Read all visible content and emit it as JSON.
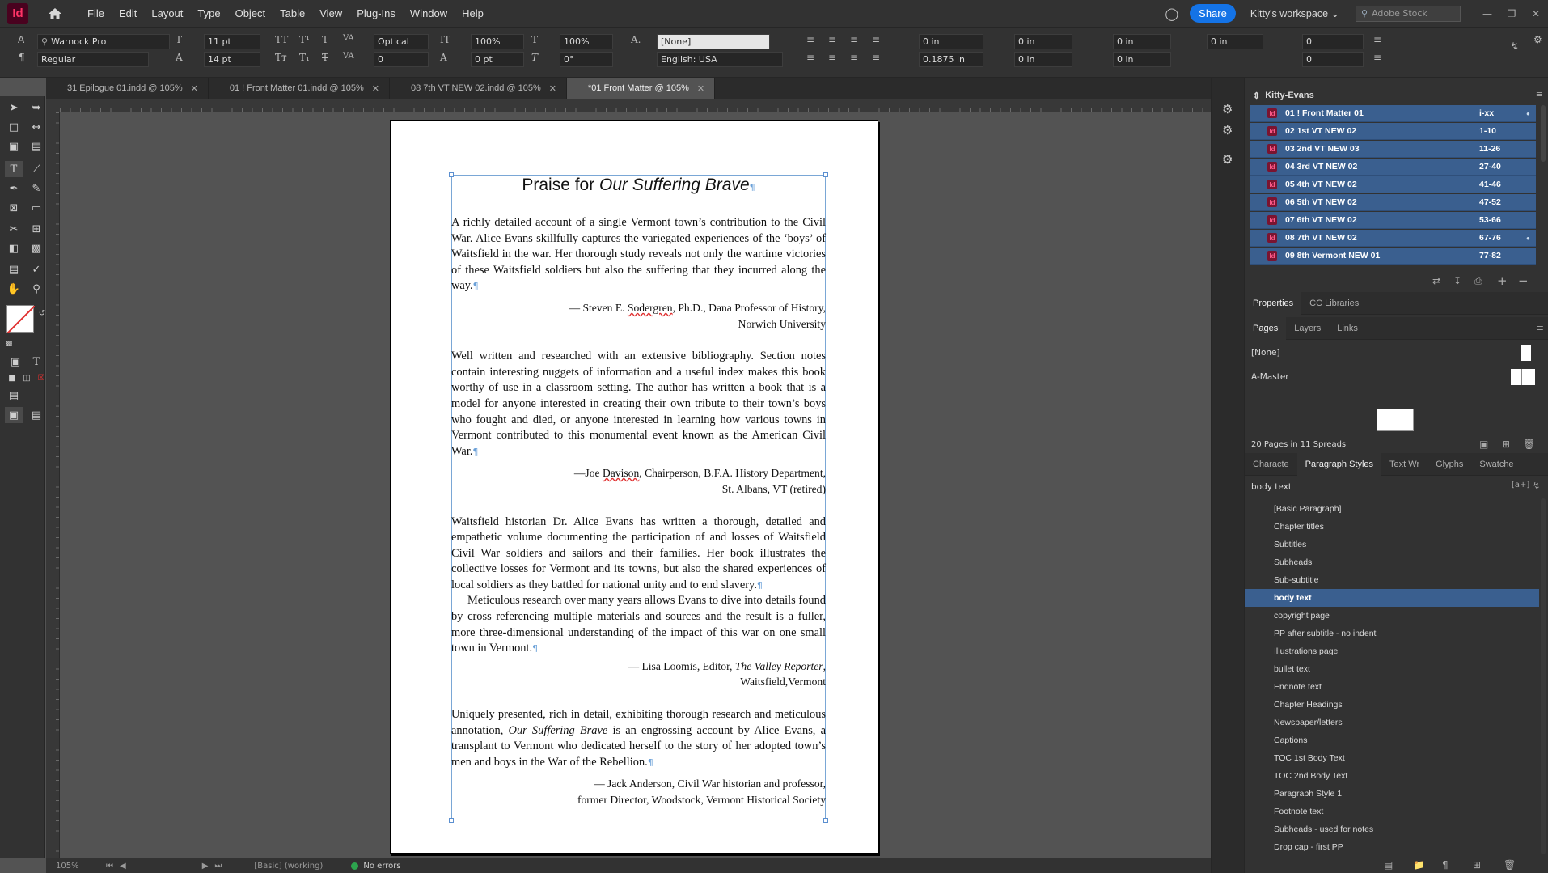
{
  "menubar": {
    "app_logo": "Id",
    "items": [
      "File",
      "Edit",
      "Layout",
      "Type",
      "Object",
      "Table",
      "View",
      "Plug-Ins",
      "Window",
      "Help"
    ],
    "share": "Share",
    "workspace": "Kitty's workspace",
    "stock_placeholder": "Adobe Stock"
  },
  "control": {
    "font_family": "Warnock Pro",
    "font_style": "Regular",
    "font_size": "11 pt",
    "leading": "14 pt",
    "kerning": "Optical",
    "tracking": "0",
    "vscale": "100%",
    "hscale": "100%",
    "baseline": "0 pt",
    "skew": "0°",
    "char_style": "[None]",
    "language": "English: USA",
    "left_indent": "0 in",
    "first_indent": "0.1875 in",
    "right_indent": "0 in",
    "last_indent": "0 in",
    "space_before": "0 in",
    "space_after": "0 in",
    "drop_before": "0 in",
    "drop_cap": "0",
    "drop_lines": "0"
  },
  "doctabs": [
    {
      "label": "31 Epilogue 01.indd @ 105%",
      "active": false
    },
    {
      "label": "01 ! Front Matter 01.indd @ 105%",
      "active": false
    },
    {
      "label": "08 7th VT NEW 02.indd @ 105%",
      "active": false
    },
    {
      "label": "*01 Front Matter @ 105%",
      "active": true
    }
  ],
  "document": {
    "title_plain": "Praise for ",
    "title_italic": "Our Suffering Brave",
    "para1": "A richly detailed account of a single Vermont town’s contribution to the Civil War. Alice Evans skillfully captures the variegated experiences of the ‘boys’ of Waitsfield in the war. Her thorough study reveals not only the wartime victories of these Waitsfield soldiers but also the suffering that they incurred along the way.",
    "attr1_a": "— Steven E. ",
    "attr1_b": "Sodergren",
    "attr1_c": ", Ph.D., Dana Professor of History,",
    "attr1_line2": "Norwich University",
    "para2": "Well written and researched with an extensive bibliography. Section notes contain interesting nuggets of information and a useful index makes this book worthy of use in a classroom setting. The author has written a book that is a model for anyone interested in creating their own tribute to their town’s boys who fought and died, or anyone interested in learning how various towns in Vermont contributed to this monumental event known as the American Civil War.",
    "attr2_a": "—Joe ",
    "attr2_b": "Davison",
    "attr2_c": ", Chairperson, B.F.A. History Department,",
    "attr2_line2": "St. Albans, VT (retired)",
    "para3": "Waitsfield historian Dr. Alice Evans has written a thorough, detailed and empathetic volume documenting the participation of and losses of Waitsfield Civil War soldiers and sailors and their families. Her book illustrates the collective losses for Vermont and its towns, but also the shared experiences of local soldiers as they battled for national unity and to end slavery.",
    "para4": "Meticulous research over many years allows Evans to dive into details found by cross referencing multiple materials and sources and the result is a fuller, more three-dimensional understanding of the impact of this war on one small town in Vermont.",
    "attr3_a": "— Lisa Loomis, Editor, ",
    "attr3_italic": "The Valley Reporter",
    "attr3_c": ",",
    "attr3_line2": "Waitsfield,Vermont",
    "para5_a": "Uniquely presented, rich in detail, exhibiting thorough research and meticulous annotation, ",
    "para5_italic": "Our Suffering Brave",
    "para5_b": " is an engrossing account by Alice Evans, a transplant to Vermont who dedicated herself to the story of her adopted town’s men and boys in the War of the Rebellion.",
    "attr4_line1": "— Jack Anderson, Civil War historian and professor,",
    "attr4_line2": "former Director, Woodstock, Vermont Historical Society"
  },
  "statusbar": {
    "zoom": "105%",
    "page": "",
    "master": "[Basic] (working)",
    "errors": "No errors"
  },
  "book": {
    "title": "Kitty-Evans",
    "rows": [
      {
        "name": "01 ! Front Matter 01",
        "pages": "i-xx",
        "status": "●"
      },
      {
        "name": "02 1st VT NEW 02",
        "pages": "1-10",
        "status": ""
      },
      {
        "name": "03 2nd VT NEW 03",
        "pages": "11-26",
        "status": ""
      },
      {
        "name": "04 3rd VT NEW 02",
        "pages": "27-40",
        "status": ""
      },
      {
        "name": "05 4th VT NEW 02",
        "pages": "41-46",
        "status": ""
      },
      {
        "name": "06 5th VT NEW 02",
        "pages": "47-52",
        "status": ""
      },
      {
        "name": "07 6th VT NEW 02",
        "pages": "53-66",
        "status": ""
      },
      {
        "name": "08 7th VT NEW 02",
        "pages": "67-76",
        "status": "●"
      },
      {
        "name": "09 8th Vermont NEW 01",
        "pages": "77-82",
        "status": ""
      }
    ]
  },
  "props_tabs": [
    "Properties",
    "CC Libraries"
  ],
  "pages_tabs": [
    "Pages",
    "Layers",
    "Links"
  ],
  "pages": {
    "none": "[None]",
    "master": "A-Master",
    "summary": "20 Pages in 11 Spreads"
  },
  "style_tabs": [
    "Characte",
    "Paragraph Styles",
    "Text Wr",
    "Glyphs",
    "Swatche"
  ],
  "styles": {
    "current": "body text",
    "list": [
      "[Basic Paragraph]",
      "Chapter titles",
      "Subtitles",
      "Subheads",
      "Sub-subtitle",
      "body text",
      "copyright page",
      "PP after subtitle - no indent",
      "Illustrations page",
      "bullet text",
      "Endnote text",
      "Chapter Headings",
      "Newspaper/letters",
      "Captions",
      "TOC 1st Body Text",
      "TOC 2nd Body Text",
      "Paragraph Style 1",
      "Footnote text",
      "Subheads - used for notes",
      "Drop cap - first PP"
    ],
    "selected": "body text"
  },
  "colors": {
    "accent": "#1473e6",
    "selection": "#3a5f8f",
    "frame": "#7aa7d6"
  }
}
